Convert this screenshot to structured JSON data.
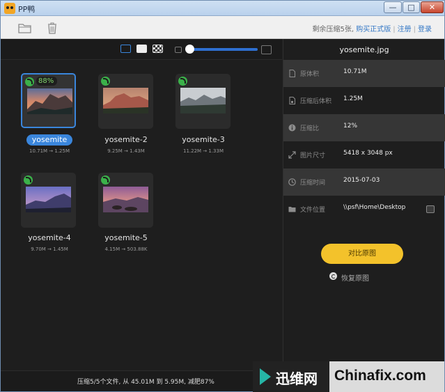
{
  "window": {
    "title": "PP鸭",
    "min_label": "—",
    "max_label": "□",
    "close_label": "✕"
  },
  "toolbar": {
    "remaining_text": "剩余压缩5张,",
    "buy_label": "购买正式版",
    "register_label": "注册",
    "login_label": "登录",
    "separator": "|"
  },
  "icons": {
    "open": "folder-open-icon",
    "delete": "trash-icon",
    "compressed": "leaf-check-icon"
  },
  "accent_color": "#3a86dc",
  "button_color": "#f3c22b",
  "thumbnails": [
    {
      "name": "yosemite",
      "sizes": "10.71M → 1.25M",
      "progress": "88%",
      "selected": true
    },
    {
      "name": "yosemite-2",
      "sizes": "9.25M → 1.43M",
      "selected": false
    },
    {
      "name": "yosemite-3",
      "sizes": "11.22M → 1.33M",
      "selected": false
    },
    {
      "name": "yosemite-4",
      "sizes": "9.70M → 1.45M",
      "selected": false
    },
    {
      "name": "yosemite-5",
      "sizes": "4.15M → 503.88K",
      "selected": false
    }
  ],
  "detail": {
    "filename": "yosemite.jpg",
    "rows": [
      {
        "label": "原体积",
        "value": "10.71M",
        "icon": "file-icon"
      },
      {
        "label": "压缩后体积",
        "value": "1.25M",
        "icon": "compressed-file-icon"
      },
      {
        "label": "压缩比",
        "value": "12%",
        "icon": "info-icon"
      },
      {
        "label": "图片尺寸",
        "value": "5418 x 3048 px",
        "icon": "resize-icon"
      },
      {
        "label": "压缩时间",
        "value": "2015-07-03",
        "icon": "clock-icon"
      },
      {
        "label": "文件位置",
        "value": "\\\\psf\\Home\\Desktop",
        "icon": "folder-icon"
      }
    ],
    "compare_label": "对比原图",
    "restore_label": "恢复原图"
  },
  "status": {
    "text": "压缩5/5个文件, 从 45.01M 到 5.95M, 减肥87%"
  },
  "watermark": {
    "cn": "迅维网",
    "en": "Chinafix.com"
  }
}
